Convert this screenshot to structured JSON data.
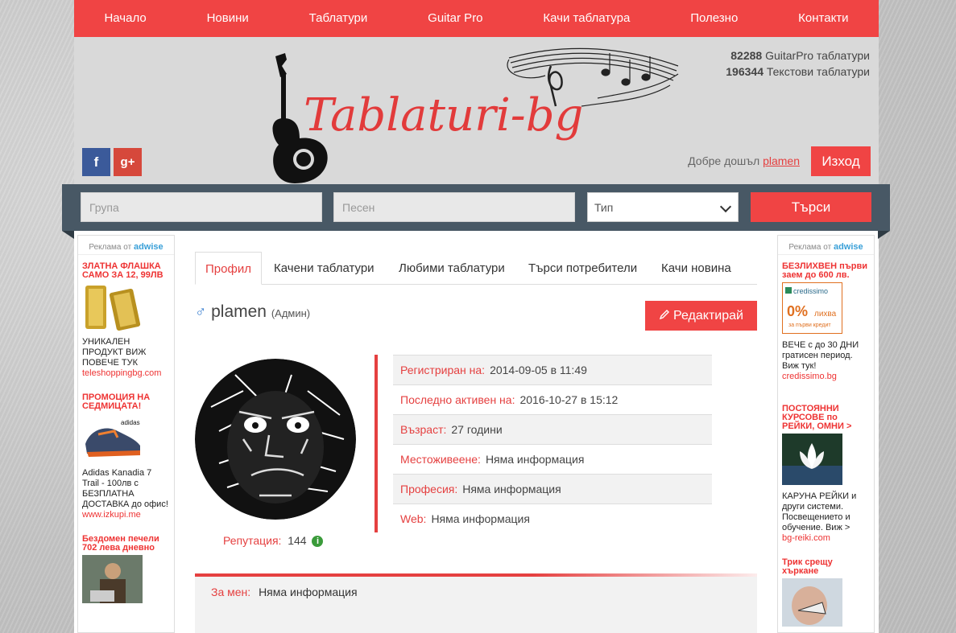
{
  "nav": [
    "Начало",
    "Новини",
    "Таблатури",
    "Guitar Pro",
    "Качи таблатура",
    "Полезно",
    "Контакти"
  ],
  "header": {
    "logo_text": "Tablaturi-bg",
    "stats": [
      {
        "count": "82288",
        "label": "GuitarPro таблатури"
      },
      {
        "count": "196344",
        "label": "Текстови таблатури"
      }
    ],
    "facebook": "f",
    "googleplus": "g+",
    "welcome": "Добре дошъл",
    "username": "plamen",
    "logout": "Изход"
  },
  "search": {
    "group_placeholder": "Група",
    "song_placeholder": "Песен",
    "type_value": "Тип",
    "button": "Търси"
  },
  "ads": {
    "header": "Реклама от",
    "brand": "adwise",
    "left": [
      {
        "title": "ЗЛАТНА ФЛАШКА САМО ЗА 12, 99ЛВ",
        "desc": "УНИКАЛЕН ПРОДУКТ ВИЖ ПОВЕЧЕ ТУК",
        "url": "teleshoppingbg.com"
      },
      {
        "title": "ПРОМОЦИЯ НА СЕДМИЦАТА!",
        "desc": "Adidas Kanadia 7 Trail - 100лв с БЕЗПЛАТНА ДОСТАВКА до офис!",
        "url": "www.izkupi.me"
      },
      {
        "title": "Бездомен печели 702 лева дневно",
        "desc": "",
        "url": ""
      }
    ],
    "right": [
      {
        "title": "БЕЗЛИХВЕН първи заем до 600 лв.",
        "desc": "ВЕЧЕ с до 30 ДНИ гратисен период. Виж тук!",
        "url": "credissimo.bg",
        "img_brand": "credissimo",
        "img_pct": "0%",
        "img_text": "лихва",
        "img_sub": "за първи кредит"
      },
      {
        "title": "ПОСТОЯННИ КУРСОВЕ по РЕЙКИ, ОМНИ >",
        "desc": "КАРУНА РЕЙКИ и други системи. Посвещението и обучение. Виж >",
        "url": "bg-reiki.com"
      },
      {
        "title": "Трик срещу хъркане",
        "desc": "",
        "url": ""
      }
    ]
  },
  "tabs": [
    "Профил",
    "Качени таблатури",
    "Любими таблатури",
    "Търси потребители",
    "Качи новина"
  ],
  "profile": {
    "gender_symbol": "♂",
    "name": "plamen",
    "role": "(Админ)",
    "edit_button": "Редактирай",
    "reputation_label": "Репутация:",
    "reputation_value": "144",
    "fields": [
      {
        "label": "Регистриран на:",
        "value": "2014-09-05 в 11:49"
      },
      {
        "label": "Последно активен на:",
        "value": "2016-10-27 в 15:12"
      },
      {
        "label": "Възраст:",
        "value": "27 години"
      },
      {
        "label": "Местоживеене:",
        "value": "Няма информация"
      },
      {
        "label": "Професия:",
        "value": "Няма информация"
      },
      {
        "label": "Web:",
        "value": "Няма информация"
      }
    ],
    "about_label": "За мен:",
    "about_value": "Няма информация"
  },
  "colors": {
    "accent": "#f04444",
    "searchbar": "#485865",
    "header_bg": "#d9d9d9"
  }
}
